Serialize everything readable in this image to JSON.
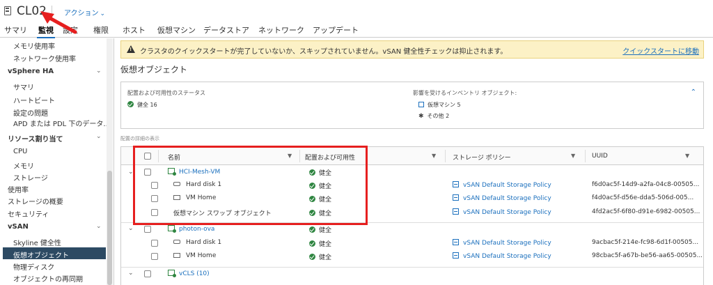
{
  "header": {
    "title": "CL02",
    "actions_label": "アクション"
  },
  "tabs": [
    {
      "label": "サマリ"
    },
    {
      "label": "監視"
    },
    {
      "label": "設定"
    },
    {
      "label": "権限"
    },
    {
      "label": "ホスト"
    },
    {
      "label": "仮想マシン"
    },
    {
      "label": "データストア"
    },
    {
      "label": "ネットワーク"
    },
    {
      "label": "アップデート"
    }
  ],
  "sidebar": {
    "items": [
      {
        "label": "メモリ使用率"
      },
      {
        "label": "ネットワーク使用率"
      },
      {
        "label": "vSphere HA"
      },
      {
        "label": "サマリ"
      },
      {
        "label": "ハートビート"
      },
      {
        "label": "設定の問題"
      },
      {
        "label": "APD または PDL 下のデータ..."
      },
      {
        "label": "リソース割り当て"
      },
      {
        "label": "CPU"
      },
      {
        "label": "メモリ"
      },
      {
        "label": "ストレージ"
      },
      {
        "label": "使用率"
      },
      {
        "label": "ストレージの概要"
      },
      {
        "label": "セキュリティ"
      },
      {
        "label": "vSAN"
      },
      {
        "label": "Skyline 健全性"
      },
      {
        "label": "仮想オブジェクト"
      },
      {
        "label": "物理ディスク"
      },
      {
        "label": "オブジェクトの再同期"
      }
    ]
  },
  "alert": {
    "text": "クラスタのクイックスタートが完了していないか、スキップされていません。vSAN 健全性チェックは抑止されます。",
    "link": "クイックスタートに移動"
  },
  "section_title": "仮想オブジェクト",
  "status_card": {
    "left_label": "配置および可用性のステータス",
    "left_value": "健全 16",
    "right_label": "影響を受けるインベントリ オブジェクト:",
    "right_vm": "仮想マシン 5",
    "right_other": "その他 2"
  },
  "placement_label": "配置の詳細の表示",
  "grid": {
    "columns": [
      "名前",
      "配置および可用性",
      "ストレージ ポリシー",
      "UUID"
    ],
    "rows": [
      {
        "name": "HCI-Mesh-VM",
        "status": "健全",
        "policy": "",
        "uuid": ""
      },
      {
        "name": "Hard disk 1",
        "status": "健全",
        "policy": "vSAN Default Storage Policy",
        "uuid": "f6d0ac5f-14d9-a2fa-04c8-00505..."
      },
      {
        "name": "VM Home",
        "status": "健全",
        "policy": "vSAN Default Storage Policy",
        "uuid": "f4d0ac5f-d56e-dda5-506d-005..."
      },
      {
        "name": "仮想マシン スワップ オブジェクト",
        "status": "健全",
        "policy": "vSAN Default Storage Policy",
        "uuid": "4fd2ac5f-6f80-d91e-6982-00505..."
      },
      {
        "name": "photon-ova",
        "status": "健全",
        "policy": "",
        "uuid": ""
      },
      {
        "name": "Hard disk 1",
        "status": "健全",
        "policy": "vSAN Default Storage Policy",
        "uuid": "9acbac5f-214e-fc98-6d1f-00505..."
      },
      {
        "name": "VM Home",
        "status": "健全",
        "policy": "vSAN Default Storage Policy",
        "uuid": "98cbac5f-a67b-be56-aa65-00505..."
      },
      {
        "name": "vCLS (10)",
        "status": "",
        "policy": "",
        "uuid": ""
      }
    ]
  }
}
